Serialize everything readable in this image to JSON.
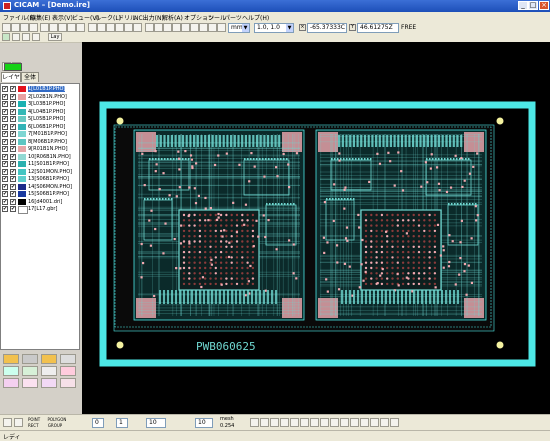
{
  "app": {
    "title": "CICAM – [Demo.ire]",
    "minimize": "_",
    "maximize": "□",
    "close": "×"
  },
  "menu": [
    "ファイル(F)",
    "編集(E)",
    "表示(V)",
    "ビュー(V)",
    "ルーク(L)",
    "ドリル",
    "NC出力(N)",
    "解析(A)",
    "オプション",
    "ツール",
    "パーツ",
    "ヘルプ(H)"
  ],
  "toolbar": {
    "unit": "mm",
    "grid": "1.0, 1.0",
    "x_coord": "-65.37333C",
    "y_coord": "46.61275Z",
    "free_label": "FREE",
    "layer_button": "Lay",
    "coord_x_icon": "x-icon",
    "coord_y_icon": "y-icon"
  },
  "left_panel": {
    "tabs": [
      "レイヤ",
      "全体"
    ],
    "active_tab": 0,
    "layers": [
      {
        "name": "1[L01B1P.PHO]",
        "color": "#e4121b",
        "selected": true
      },
      {
        "name": "2[L02B1N.PHO]",
        "color": "#e9a0a2",
        "selected": false
      },
      {
        "name": "3[L03B1P.PHO]",
        "color": "#1bb1b1",
        "selected": false
      },
      {
        "name": "4[L04B1P.PHO]",
        "color": "#34b8b6",
        "selected": false
      },
      {
        "name": "5[L05B1P.PHO]",
        "color": "#6bcac3",
        "selected": false
      },
      {
        "name": "6[L06B1P.PHO]",
        "color": "#32b3b7",
        "selected": false
      },
      {
        "name": "7[M01B1P.PHO]",
        "color": "#7fd6d3",
        "selected": false
      },
      {
        "name": "8[M06B1P.PHO]",
        "color": "#5dc6c2",
        "selected": false
      },
      {
        "name": "9[R01B1N.PHO]",
        "color": "#e6a7a8",
        "selected": false
      },
      {
        "name": "10[R06B1N.PHO]",
        "color": "#93d9d3",
        "selected": false
      },
      {
        "name": "11[S01B1P.PHO]",
        "color": "#2cb0af",
        "selected": false
      },
      {
        "name": "12[S01MON.PHO]",
        "color": "#43c5c2",
        "selected": false
      },
      {
        "name": "13[S06B1P.PHO]",
        "color": "#5fcfcd",
        "selected": false
      },
      {
        "name": "14[S06MON.PHO]",
        "color": "#1d2c8a",
        "selected": false
      },
      {
        "name": "15[S06B1P.PHO]",
        "color": "#1a3aa0",
        "selected": false
      },
      {
        "name": "16[d4001.dri]",
        "color": "#000000",
        "selected": false
      },
      {
        "name": "17[L17.gbr]",
        "color": "#ffffff",
        "selected": false
      }
    ]
  },
  "canvas": {
    "board_label": "PWB060625",
    "colors": {
      "background": "#000000",
      "frame": "#4de8e6",
      "trace": "#6fd7d0",
      "pad": "#f2a9b0",
      "fiducial": "#f4f2a0"
    }
  },
  "bottom": {
    "option_point": "POINT",
    "option_polygon": "POLYGON",
    "option_rect": "RECT",
    "option_group": "GROUP",
    "field1": "0",
    "field2": "1",
    "field3": "10",
    "field4": "10",
    "info_label": "mesh",
    "info_value": "0.254"
  },
  "status": {
    "text": "レディ"
  }
}
